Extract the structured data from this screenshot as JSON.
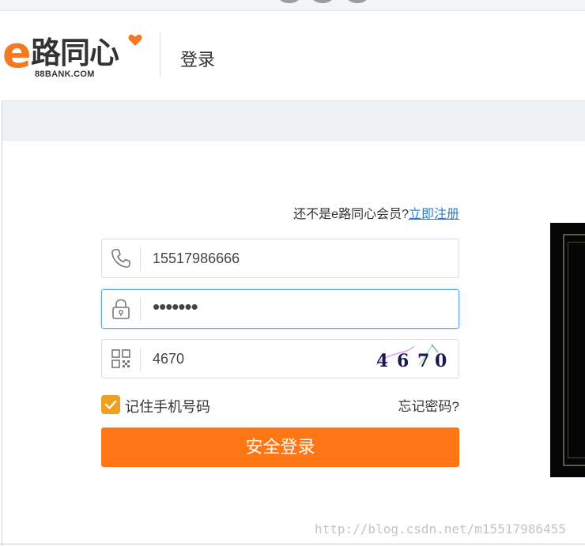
{
  "header": {
    "logo_letter": "e",
    "logo_text": "路同心",
    "logo_sub": "88BANK.COM",
    "title": "登录"
  },
  "register": {
    "prompt": "还不是e路同心会员?",
    "link": "立即注册"
  },
  "form": {
    "phone_value": "15517986666",
    "password_mask": "•••••••",
    "captcha_value": "4670",
    "captcha_image_chars": [
      "4",
      "6",
      "7",
      "0"
    ],
    "remember_label": "记住手机号码",
    "remember_checked": true,
    "forgot_label": "忘记密码?",
    "login_label": "安全登录"
  },
  "icons": {
    "phone": "phone-icon",
    "lock": "lock-icon",
    "qr": "qr-code-icon",
    "check": "check-icon"
  },
  "colors": {
    "brand_orange": "#f47a1f",
    "button_orange": "#ff7615",
    "checkbox": "#f0a01c",
    "link_blue": "#2b7bd8",
    "focus_border": "#63a3e8"
  },
  "watermark": "http://blog.csdn.net/m15517986455"
}
